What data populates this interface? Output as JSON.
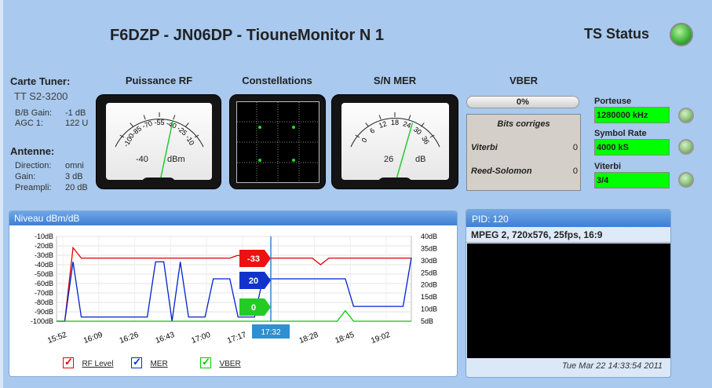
{
  "header": {
    "title": "F6DZP - JN06DP - TiouneMonitor N 1",
    "ts_status_label": "TS Status"
  },
  "tuner": {
    "heading": "Carte Tuner:",
    "model": "TT S2-3200",
    "rows": [
      {
        "label": "B/B Gain:",
        "value": "-1 dB"
      },
      {
        "label": "AGC 1:",
        "value": "122 U"
      }
    ]
  },
  "antenna": {
    "heading": "Antenne:",
    "rows": [
      {
        "label": "Direction:",
        "value": "omni"
      },
      {
        "label": "Gain:",
        "value": "3 dB"
      },
      {
        "label": "Preampli:",
        "value": "20 dB"
      }
    ]
  },
  "meters": {
    "rf": {
      "heading": "Puissance RF",
      "value": "-40",
      "unit": "dBm",
      "ticks": [
        "-100",
        "-85",
        "-70",
        "-55",
        "-40",
        "-25",
        "-10"
      ]
    },
    "constellations": {
      "heading": "Constellations"
    },
    "mer": {
      "heading": "S/N MER",
      "value": "26",
      "unit": "dB",
      "ticks": [
        "0",
        "6",
        "12",
        "18",
        "24",
        "30",
        "36"
      ]
    },
    "vber": {
      "heading": "VBER",
      "bar_text": "0%"
    }
  },
  "bits": {
    "title": "Bits corriges",
    "viterbi_label": "Viterbi",
    "viterbi_value": "0",
    "rs_label": "Reed-Solomon",
    "rs_value": "0"
  },
  "params": {
    "porteuse_label": "Porteuse",
    "porteuse_value": "1280000 kHz",
    "symbol_label": "Symbol Rate",
    "symbol_value": "4000 kS",
    "viterbi_label": "Viterbi",
    "viterbi_value": "3/4"
  },
  "chart_panel": {
    "title": "Niveau dBm/dB"
  },
  "chart_data": {
    "type": "line",
    "x_ticks": [
      "15:52",
      "16:09",
      "16:26",
      "16:43",
      "17:00",
      "17:17",
      "17:32",
      "18:28",
      "18:45",
      "19:02"
    ],
    "y_left_ticks": [
      "-10dB",
      "-20dB",
      "-30dB",
      "-40dB",
      "-50dB",
      "-60dB",
      "-70dB",
      "-80dB",
      "-90dB",
      "-100dB"
    ],
    "y_right_ticks": [
      "40dB",
      "35dB",
      "30dB",
      "25dB",
      "20dB",
      "15dB",
      "10dB",
      "5dB"
    ],
    "ylim_left": [
      -100,
      -10
    ],
    "ylim_right": [
      0,
      40
    ],
    "cursor_label": "17:32",
    "markers": [
      {
        "label": "-33",
        "color": "#ee1111"
      },
      {
        "label": "20",
        "color": "#1133cc"
      },
      {
        "label": "0",
        "color": "#22cc22"
      }
    ],
    "series": [
      {
        "name": "RF Level",
        "color": "#e00000",
        "axis": "left",
        "values": [
          -100,
          -100,
          -22,
          -33,
          -33,
          -33,
          -33,
          -33,
          -33,
          -33,
          -33,
          -33,
          -33,
          -33,
          -33,
          -33,
          -33,
          -33,
          -33,
          -33,
          -33,
          -33,
          -30,
          -33,
          -33,
          -33,
          -33,
          -33,
          -33,
          -33,
          -33,
          -33,
          -40,
          -33,
          -33,
          -33,
          -33,
          -33,
          -33,
          -33,
          -33,
          -33,
          -33,
          -33
        ]
      },
      {
        "name": "MER",
        "color": "#0022cc",
        "axis": "right",
        "values": [
          0,
          0,
          28,
          2,
          2,
          2,
          2,
          2,
          2,
          2,
          2,
          2,
          28,
          28,
          0,
          28,
          2,
          2,
          2,
          20,
          20,
          20,
          2,
          2,
          2,
          20,
          20,
          20,
          20,
          20,
          20,
          20,
          20,
          20,
          20,
          20,
          7,
          7,
          7,
          7,
          7,
          7,
          7,
          30
        ]
      },
      {
        "name": "VBER",
        "color": "#00cc00",
        "axis": "right",
        "values": [
          0,
          0,
          0,
          0,
          0,
          0,
          0,
          0,
          0,
          0,
          0,
          0,
          0,
          0,
          0,
          0,
          0,
          0,
          0,
          0,
          0,
          0,
          0,
          0,
          0,
          0,
          0,
          0,
          0,
          0,
          0,
          0,
          0,
          0,
          0,
          5,
          0,
          0,
          0,
          0,
          0,
          0,
          0,
          0
        ]
      }
    ]
  },
  "legend": [
    {
      "label": "RF Level",
      "color": "red"
    },
    {
      "label": "MER",
      "color": "blue"
    },
    {
      "label": "VBER",
      "color": "green"
    }
  ],
  "pid": {
    "title": "PID: 120",
    "info": "MPEG 2, 720x576, 25fps, 16:9",
    "date": "Tue Mar 22 14:33:54 2011"
  }
}
